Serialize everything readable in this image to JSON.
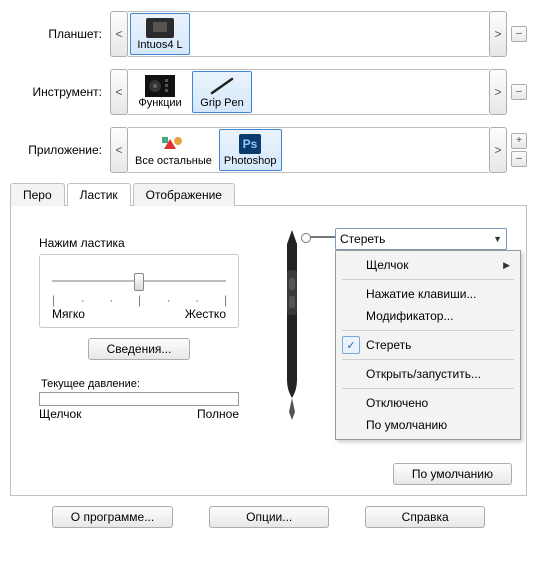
{
  "rows": {
    "tablet": {
      "label": "Планшет:",
      "items": [
        {
          "label": "Intuos4  L",
          "selected": true,
          "icon": "tablet"
        }
      ]
    },
    "tool": {
      "label": "Инструмент:",
      "items": [
        {
          "label": "Функции",
          "selected": false,
          "icon": "functions"
        },
        {
          "label": "Grip Pen",
          "selected": true,
          "icon": "pen"
        }
      ]
    },
    "app": {
      "label": "Приложение:",
      "items": [
        {
          "label": "Все остальные",
          "selected": false,
          "icon": "apps"
        },
        {
          "label": "Photoshop",
          "selected": true,
          "icon": "ps"
        }
      ]
    }
  },
  "scroll": {
    "left": "<",
    "right": ">"
  },
  "side": {
    "plus": "+",
    "minus": "–"
  },
  "tabs": {
    "pen": "Перо",
    "eraser": "Ластик",
    "display": "Отображение",
    "active": "eraser"
  },
  "panel": {
    "pressure_title": "Нажим ластика",
    "soft": "Мягко",
    "hard": "Жестко",
    "details": "Сведения...",
    "current_label": "Текущее давление:",
    "click": "Щелчок",
    "full": "Полное",
    "default": "По умолчанию"
  },
  "combo": {
    "value": "Стереть"
  },
  "menu": {
    "click": "Щелчок",
    "keypress": "Нажатие клавиши...",
    "modifier": "Модификатор...",
    "erase": "Стереть",
    "open": "Открыть/запустить...",
    "disabled": "Отключено",
    "default": "По умолчанию"
  },
  "footer": {
    "about": "О программе...",
    "options": "Опции...",
    "help": "Справка"
  }
}
